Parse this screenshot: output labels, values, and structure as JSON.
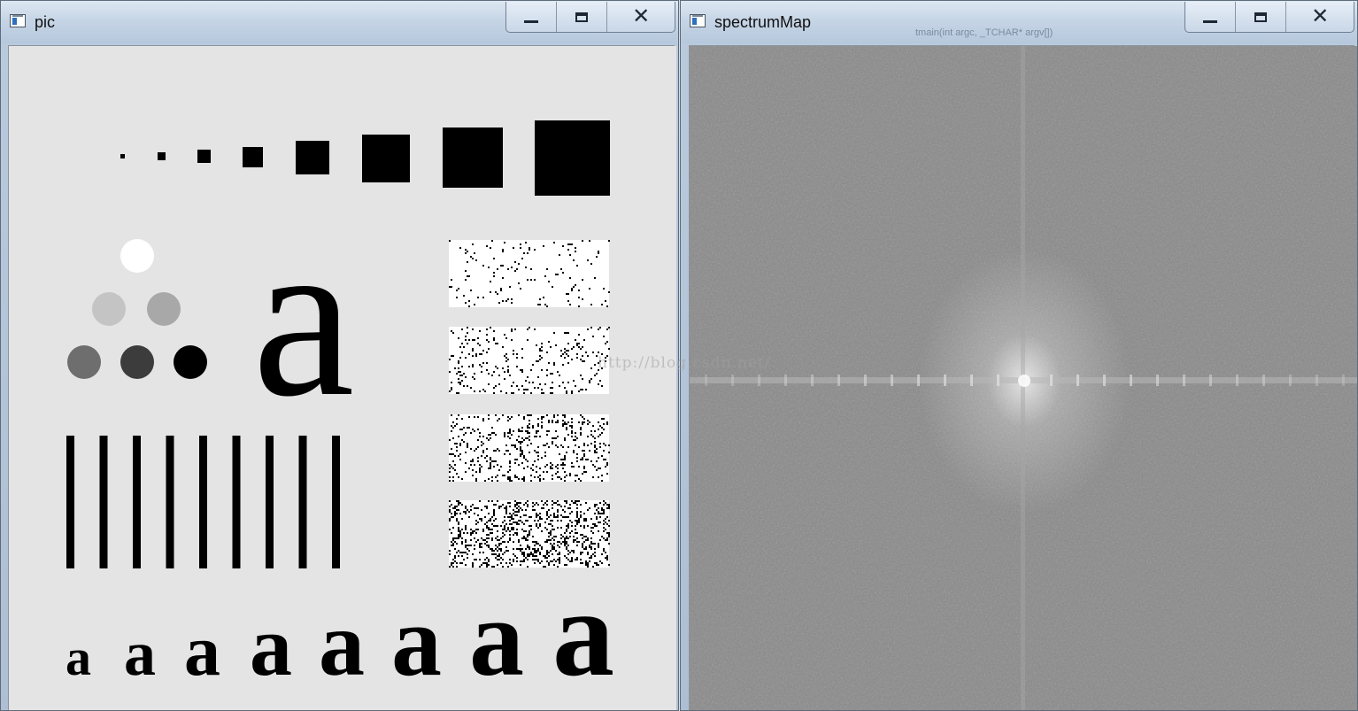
{
  "windows": {
    "pic": {
      "title": "pic"
    },
    "spectrum": {
      "title": "spectrumMap"
    }
  },
  "caption_buttons": {
    "minimize": "minimize-icon",
    "maximize": "maximize-icon",
    "close": "close-icon"
  },
  "close_glyph": "✕",
  "background_editor_text": "tmain(int argc, _TCHAR* argv[])",
  "watermark": "http://blog.csdn.net/",
  "test_pattern": {
    "large_letter": "a",
    "small_letters": [
      "a",
      "a",
      "a",
      "a",
      "a",
      "a",
      "a",
      "a"
    ],
    "bar_count": 9,
    "square_count": 8,
    "circle_count": 6,
    "noise_block_count": 4,
    "noise_density": [
      0.04,
      0.08,
      0.14,
      0.22
    ]
  },
  "colors": {
    "pic_background": "#e4e4e4",
    "spectrum_background": "#8a8a8a",
    "ink": "#000000"
  }
}
